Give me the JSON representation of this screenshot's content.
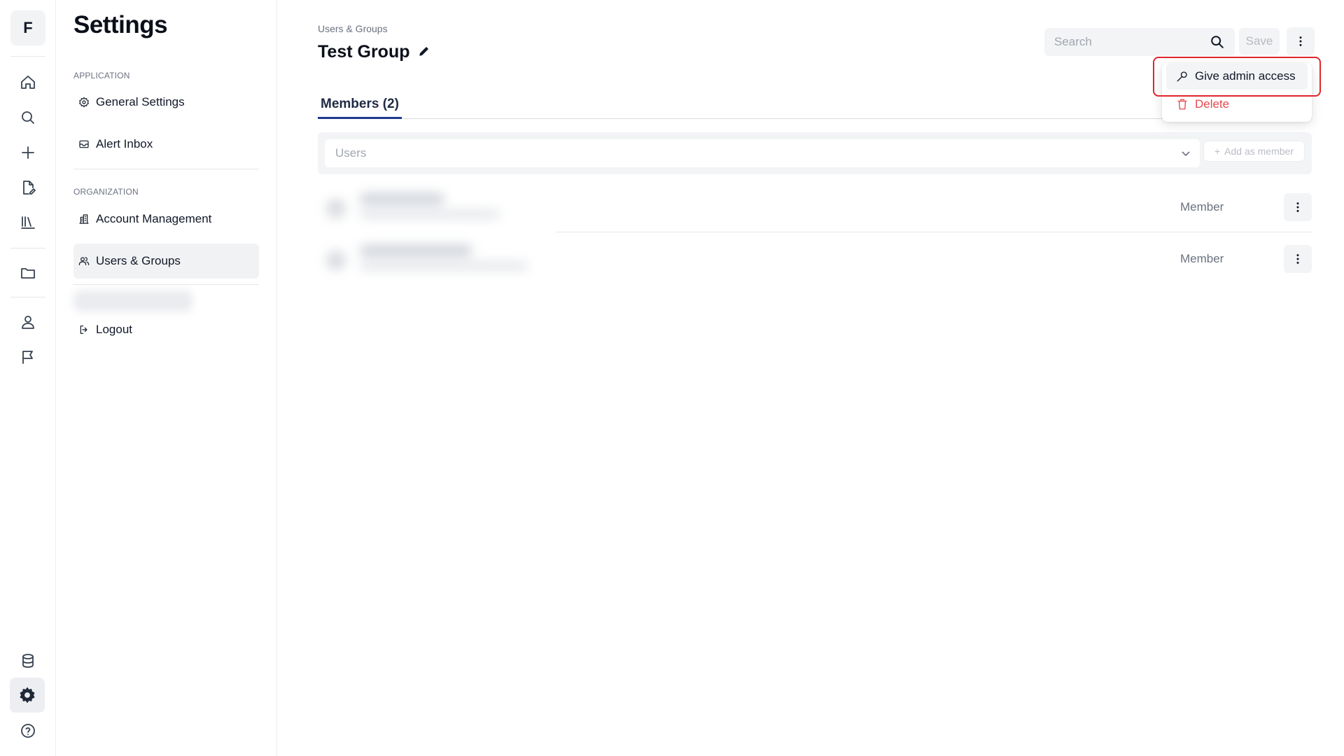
{
  "rail": {
    "logo_letter": "F",
    "icons": [
      "home-icon",
      "search-icon",
      "plus-icon",
      "edit-document-icon",
      "library-icon",
      "folder-icon",
      "user-icon",
      "flag-icon",
      "database-icon",
      "gear-icon",
      "help-icon"
    ],
    "active": "gear-icon"
  },
  "settings": {
    "title": "Settings",
    "sections": [
      {
        "label": "APPLICATION",
        "items": [
          {
            "label": "General Settings",
            "icon": "gear-icon"
          },
          {
            "label": "Alert Inbox",
            "icon": "inbox-icon"
          }
        ]
      },
      {
        "label": "ORGANIZATION",
        "items": [
          {
            "label": "Account Management",
            "icon": "building-icon"
          },
          {
            "label": "Users & Groups",
            "icon": "users-icon",
            "selected": true
          }
        ]
      }
    ],
    "logout_label": "Logout"
  },
  "page": {
    "breadcrumb": "Users & Groups",
    "title": "Test Group",
    "search_placeholder": "Search",
    "save_label": "Save",
    "tab_label": "Members (2)",
    "users_placeholder": "Users",
    "add_member_label": "Add as member",
    "members": [
      {
        "role": "Member"
      },
      {
        "role": "Member"
      }
    ]
  },
  "menu": {
    "items": [
      {
        "label": "Give admin access",
        "icon": "key-icon",
        "highlighted": true
      },
      {
        "label": "Delete",
        "icon": "trash-icon",
        "color": "#e5484d"
      }
    ]
  },
  "colors": {
    "accent_tab": "#1f3a8a",
    "danger": "#e5484d",
    "highlight_outline": "#e0262c"
  }
}
